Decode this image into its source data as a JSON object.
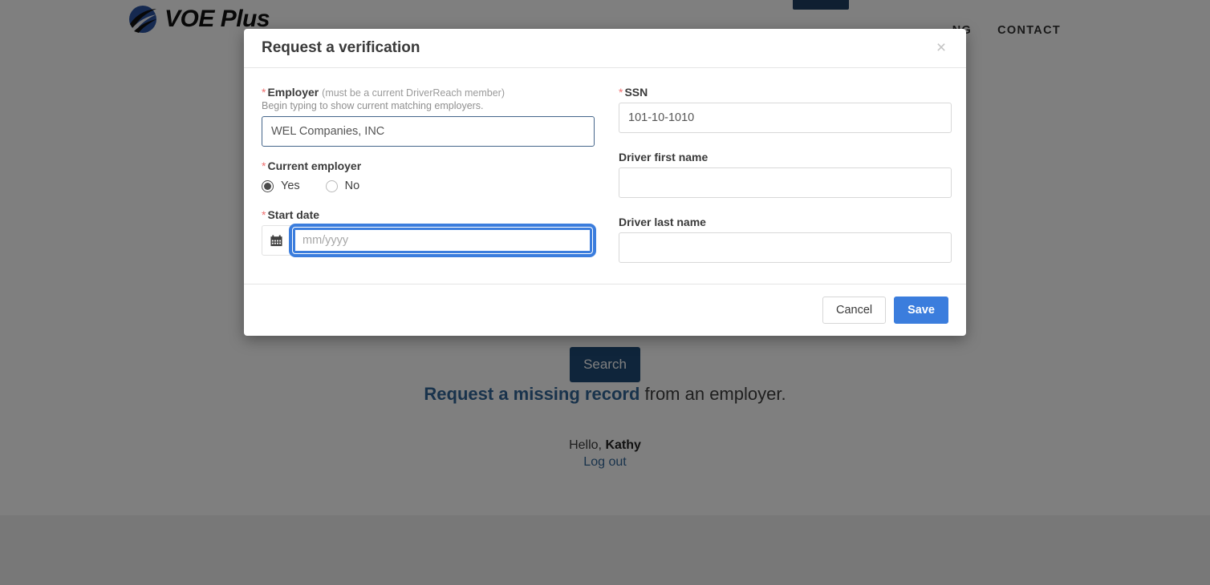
{
  "site": {
    "brand_name": "VOE Plus",
    "nav_items": [
      {
        "label": "NG"
      },
      {
        "label": "CONTACT"
      }
    ],
    "search_button_label": "Search",
    "missing_record_link": "Request a missing record",
    "missing_record_suffix": " from an employer.",
    "greeting_prefix": "Hello, ",
    "greeting_name": "Kathy",
    "logout_label": "Log out"
  },
  "modal": {
    "title": "Request a verification",
    "close_label": "×",
    "left_column": {
      "employer": {
        "required_marker": "*",
        "label": "Employer",
        "label_note": "(must be a current DriverReach member)",
        "hint": "Begin typing to show current matching employers.",
        "value": "WEL Companies, INC",
        "placeholder": ""
      },
      "current_employer": {
        "required_marker": "*",
        "label": "Current employer",
        "options": [
          {
            "label": "Yes",
            "selected": true
          },
          {
            "label": "No",
            "selected": false
          }
        ]
      },
      "start_date": {
        "required_marker": "*",
        "label": "Start date",
        "value": "",
        "placeholder": "mm/yyyy",
        "calendar_icon": "calendar-icon"
      }
    },
    "right_column": {
      "ssn": {
        "required_marker": "*",
        "label": "SSN",
        "value": "101-10-1010",
        "placeholder": ""
      },
      "driver_first_name": {
        "label": "Driver first name",
        "value": "",
        "placeholder": ""
      },
      "driver_last_name": {
        "label": "Driver last name",
        "value": "",
        "placeholder": ""
      }
    },
    "footer": {
      "cancel_label": "Cancel",
      "save_label": "Save"
    }
  },
  "colors": {
    "primary_blue": "#3b7ddd",
    "dark_navy": "#1f4a77",
    "link_blue": "#336799",
    "required_red": "#ef6f6f"
  }
}
